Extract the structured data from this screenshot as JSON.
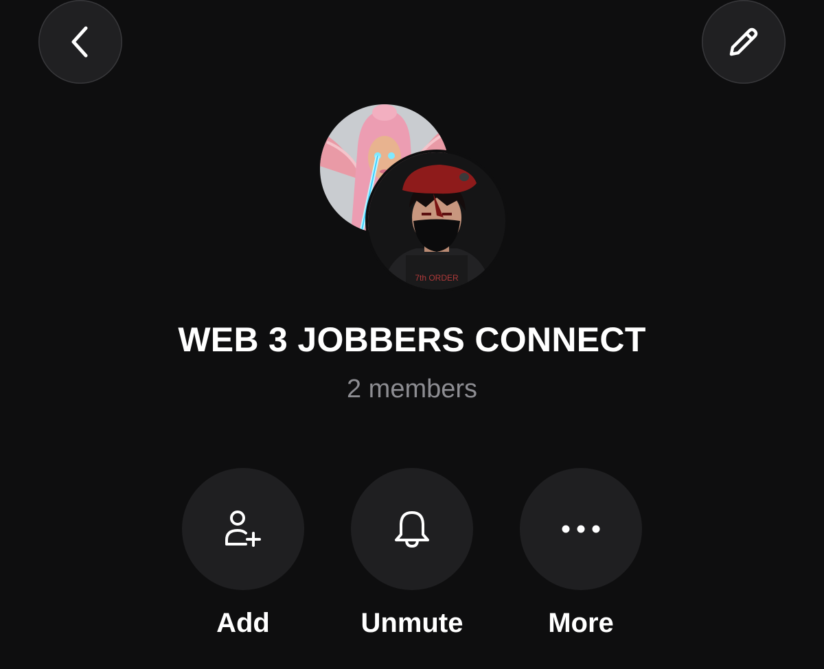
{
  "header": {
    "back_icon": "chevron-left-icon",
    "edit_icon": "pencil-icon"
  },
  "group": {
    "title": "WEB 3 JOBBERS CONNECT",
    "members": "2 members",
    "avatar_2_badge": "7th ORDER"
  },
  "actions": [
    {
      "label": "Add",
      "icon": "add-person-icon"
    },
    {
      "label": "Unmute",
      "icon": "bell-icon"
    },
    {
      "label": "More",
      "icon": "ellipsis-icon"
    }
  ],
  "colors": {
    "background": "#0e0e0f",
    "button": "#1f1f21",
    "text_primary": "#ffffff",
    "text_secondary": "#8d8d92"
  }
}
